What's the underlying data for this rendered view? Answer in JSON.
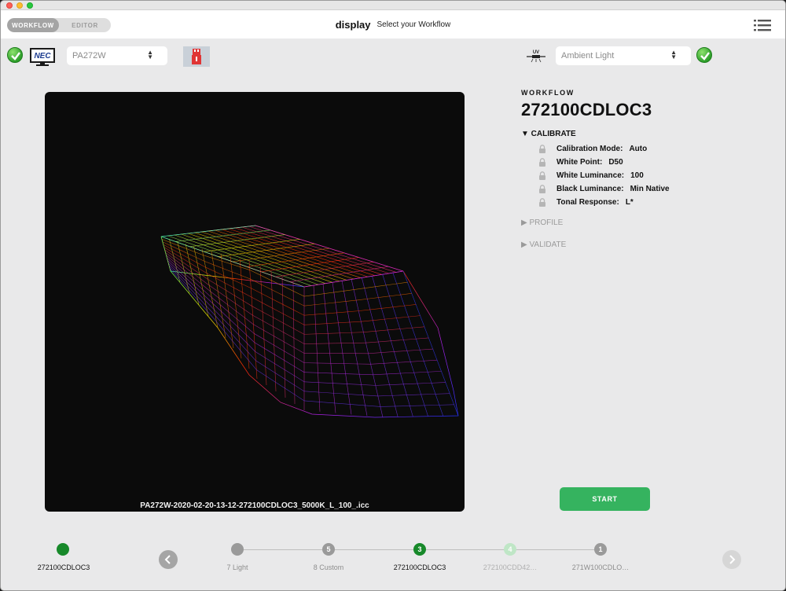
{
  "header": {
    "tabs": [
      {
        "label": "WORKFLOW",
        "active": true
      },
      {
        "label": "EDITOR",
        "active": false
      }
    ],
    "title": "display",
    "subtitle": "Select your Workflow"
  },
  "device": {
    "brand_logo_text": "NEC",
    "display_select": {
      "value": "PA272W"
    },
    "ambient_select": {
      "value": "Ambient Light"
    },
    "uv_icon_text": "UV"
  },
  "viewer": {
    "filename": "PA272W-2020-02-20-13-12-272100CDLOC3_5000K_L_100_.icc"
  },
  "workflow": {
    "label": "WORKFLOW",
    "name": "272100CDLOC3",
    "calibrate": {
      "title": "▼ CALIBRATE",
      "params": [
        {
          "key": "Calibration Mode:",
          "value": "Auto"
        },
        {
          "key": "White Point:",
          "value": "D50"
        },
        {
          "key": "White Luminance:",
          "value": "100"
        },
        {
          "key": "Black Luminance:",
          "value": "Min Native"
        },
        {
          "key": "Tonal Response:",
          "value": "L*"
        }
      ]
    },
    "profile_title": "▶ PROFILE",
    "validate_title": "▶ VALIDATE"
  },
  "start_button": {
    "label": "START"
  },
  "steps": {
    "current_workflow": "272100CDLOC3",
    "items": [
      {
        "number": "",
        "label": "7 Light",
        "state": "normal"
      },
      {
        "number": "5",
        "label": "8 Custom",
        "state": "normal"
      },
      {
        "number": "3",
        "label": "272100CDLOC3",
        "state": "current"
      },
      {
        "number": "4",
        "label": "272100CDD42…",
        "state": "faded"
      },
      {
        "number": "1",
        "label": "271W100CDLO…",
        "state": "normal"
      }
    ]
  },
  "colors": {
    "accent_green": "#35b35f",
    "step_green": "#17892a",
    "step_gray": "#9a9a9a",
    "step_faded": "#bfe6c6"
  }
}
